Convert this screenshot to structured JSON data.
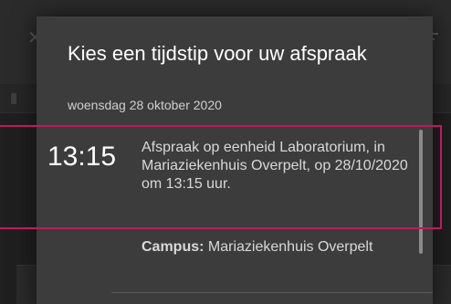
{
  "dialog": {
    "title": "Kies een tijdstip voor uw afspraak",
    "date": "woensdag 28 oktober 2020",
    "slots": [
      {
        "time": "13:15",
        "description": "Afspraak op eenheid Laboratorium, in Mariaziekenhuis Overpelt, op 28/10/2020 om 13:15 uur.",
        "campus_label": "Campus:",
        "campus_value": "Mariaziekenhuis Overpelt"
      }
    ]
  },
  "background": {
    "icons": [
      "close-icon",
      "menu-icon"
    ]
  },
  "colors": {
    "dialog_bg": "#3c3c3c",
    "highlight": "#c2185b",
    "background": "#1f1f1f"
  }
}
